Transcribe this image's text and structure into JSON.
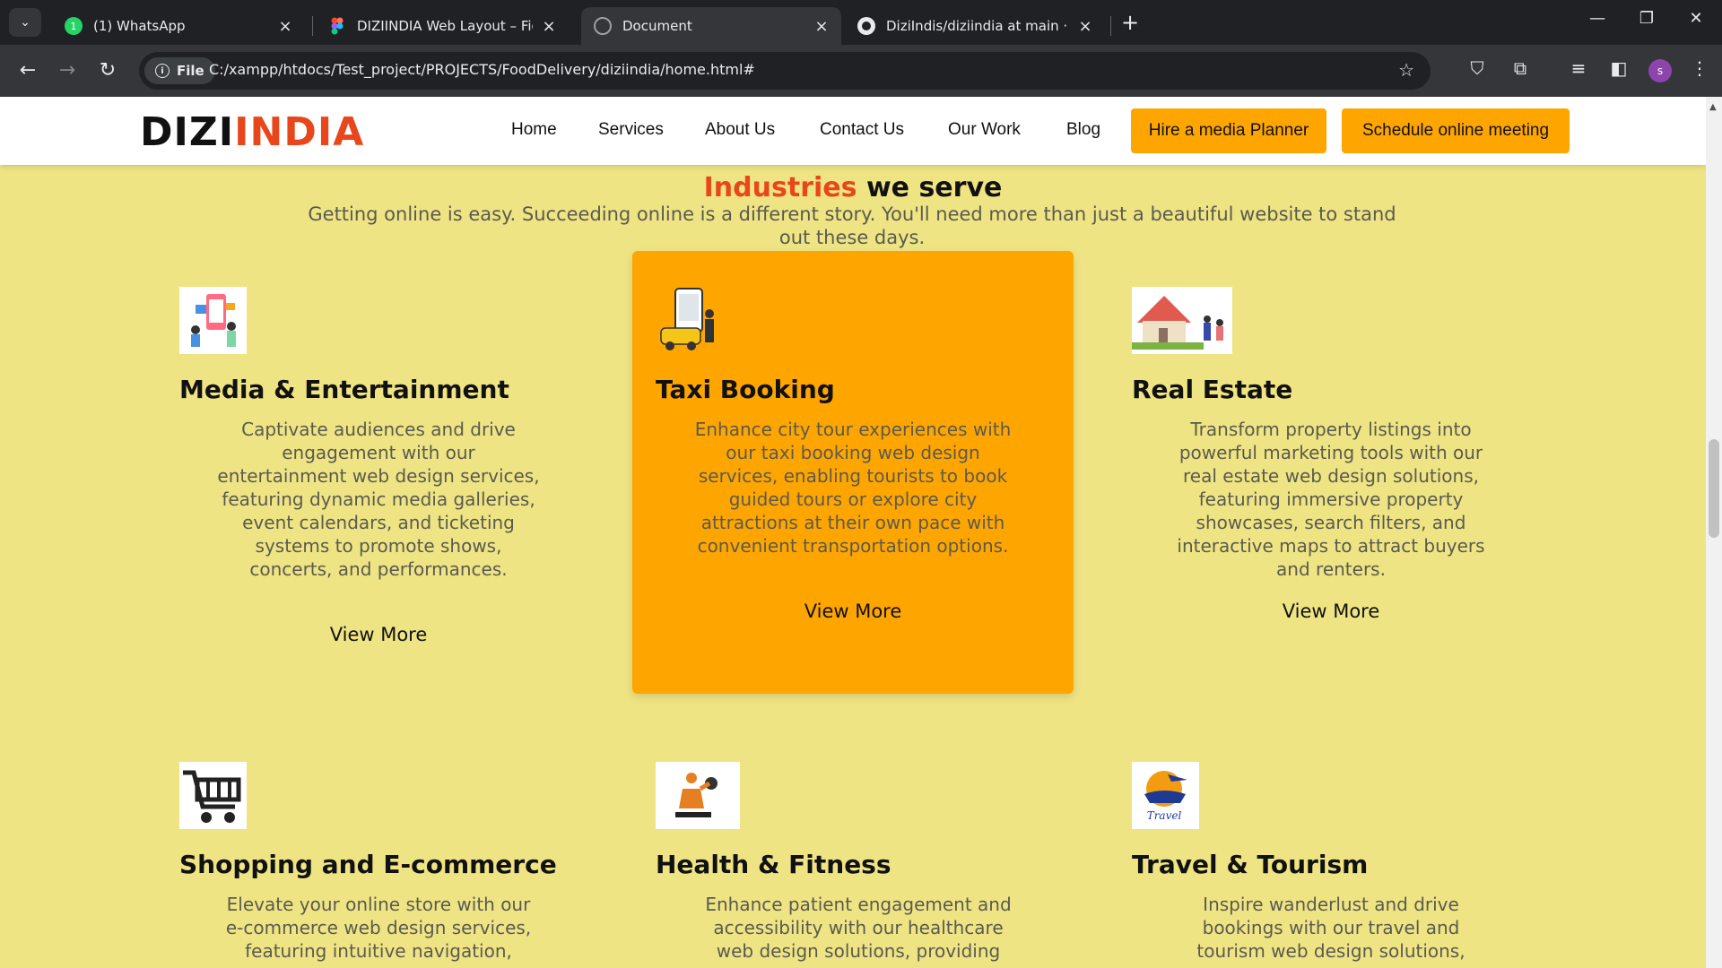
{
  "browser": {
    "tabs": [
      {
        "title": "(1) WhatsApp",
        "favicon": "whatsapp-icon"
      },
      {
        "title": "DIZIINDIA Web Layout – Figma",
        "favicon": "figma-icon"
      },
      {
        "title": "Document",
        "favicon": "globe-icon",
        "active": true
      },
      {
        "title": "DiziIndis/diziindia at main · sha",
        "favicon": "github-icon"
      }
    ],
    "url_chip": "File",
    "url": "C:/xampp/htdocs/Test_project/PROJECTS/FoodDelivery/diziindia/home.html#",
    "profile_initial": "s"
  },
  "site": {
    "logo_part1": "DIZI",
    "logo_part2": "INDIA",
    "nav": [
      "Home",
      "Services",
      "About Us",
      "Contact Us",
      "Our Work",
      "Blog"
    ],
    "cta_primary": "Hire a media Planner",
    "cta_secondary": "Schedule online meeting",
    "section_title_highlight": "Industries",
    "section_title_rest": "we serve",
    "section_subtitle": "Getting online is easy. Succeeding online is a different story. You'll need more than just a beautiful website to stand out these days.",
    "cards": [
      {
        "title": "Media & Entertainment",
        "icon": "media-entertainment-icon",
        "desc": "Captivate audiences and drive engagement with our entertainment web design services, featuring dynamic media galleries, event calendars, and ticketing systems to promote shows, concerts, and performances.",
        "link": "View More"
      },
      {
        "title": "Taxi Booking",
        "icon": "taxi-booking-icon",
        "desc": "Enhance city tour experiences with our taxi booking web design services, enabling tourists to book guided tours or explore city attractions at their own pace with convenient transportation options.",
        "link": "View More"
      },
      {
        "title": "Real Estate",
        "icon": "real-estate-icon",
        "desc": "Transform property listings into powerful marketing tools with our real estate web design solutions, featuring immersive property showcases, search filters, and interactive maps to attract buyers and renters.",
        "link": "View More"
      },
      {
        "title": "Shopping and E-commerce",
        "icon": "shopping-cart-icon",
        "desc": "Elevate your online store with our e-commerce web design services, featuring intuitive navigation,",
        "link": ""
      },
      {
        "title": "Health & Fitness",
        "icon": "fitness-icon",
        "desc": "Enhance patient engagement and accessibility with our healthcare web design solutions, providing",
        "link": ""
      },
      {
        "title": "Travel & Tourism",
        "icon": "travel-icon",
        "icon_text": "Travel",
        "desc": "Inspire wanderlust and drive bookings with our travel and tourism web design solutions,",
        "link": ""
      }
    ]
  },
  "colors": {
    "page_bg": "#efe483",
    "accent": "#ffa500",
    "brand_red": "#e8471c",
    "chrome_dark": "#202124"
  }
}
